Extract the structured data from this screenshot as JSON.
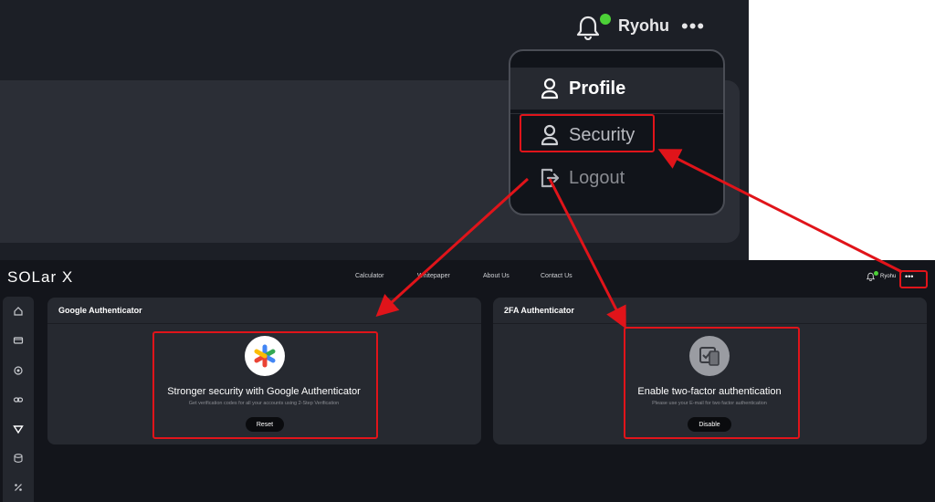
{
  "zoom": {
    "username": "Ryohu",
    "more_label": "•••",
    "menu": {
      "profile": "Profile",
      "security": "Security",
      "logout": "Logout"
    }
  },
  "header": {
    "logo": "SOLar X",
    "nav": [
      "Calculator",
      "Whitepaper",
      "About Us",
      "Contact Us"
    ],
    "username": "Ryohu",
    "more_label": "•••"
  },
  "cards": {
    "google": {
      "title": "Google Authenticator",
      "heading": "Stronger security with Google Authenticator",
      "description": "Get verification codes for all your accounts using 2-Step Verification",
      "button": "Reset"
    },
    "twofa": {
      "title": "2FA Authenticator",
      "heading": "Enable two-factor authentication",
      "description": "Please use your E-mail for two factor authentication",
      "button": "Disable"
    }
  },
  "colors": {
    "accent_green": "#4cd137",
    "highlight_red": "#e0141a"
  }
}
